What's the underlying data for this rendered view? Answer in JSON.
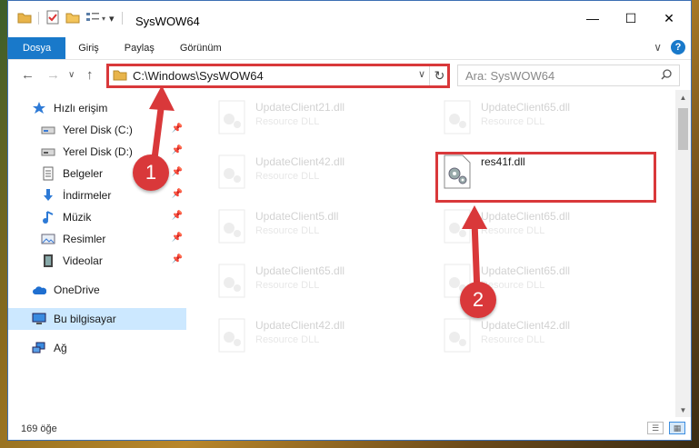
{
  "window": {
    "title": "SysWOW64",
    "minimize": "—",
    "maximize": "☐",
    "close": "✕"
  },
  "ribbon": {
    "tabs": [
      "Dosya",
      "Giriş",
      "Paylaş",
      "Görünüm"
    ],
    "expand": "∨",
    "help": "?"
  },
  "nav": {
    "back": "←",
    "forward": "→",
    "recent": "∨",
    "up": "↑",
    "address": "C:\\Windows\\SysWOW64",
    "address_dropdown": "∨",
    "refresh": "↻",
    "search_placeholder": "Ara: SysWOW64"
  },
  "sidebar": {
    "items": [
      {
        "label": "Hızlı erişim",
        "icon": "star-icon"
      },
      {
        "label": "Yerel Disk (C:)",
        "icon": "drive-icon"
      },
      {
        "label": "Yerel Disk (D:)",
        "icon": "drive-icon"
      },
      {
        "label": "Belgeler",
        "icon": "documents-icon"
      },
      {
        "label": "İndirmeler",
        "icon": "download-icon"
      },
      {
        "label": "Müzik",
        "icon": "music-icon"
      },
      {
        "label": "Resimler",
        "icon": "pictures-icon"
      },
      {
        "label": "Videolar",
        "icon": "video-icon"
      },
      {
        "label": "OneDrive",
        "icon": "cloud-icon"
      },
      {
        "label": "Bu bilgisayar",
        "icon": "computer-icon"
      },
      {
        "label": "Ağ",
        "icon": "network-icon"
      }
    ]
  },
  "files": [
    {
      "name": "UpdateClient21.dll",
      "type": "Resource DLL"
    },
    {
      "name": "UpdateClient65.dll",
      "type": "Resource DLL"
    },
    {
      "name": "UpdateClient42.dll",
      "type": "Resource DLL"
    },
    {
      "name": "res41f.dll",
      "type": ""
    },
    {
      "name": "UpdateClient5.dll",
      "type": "Resource DLL"
    },
    {
      "name": "UpdateClient65.dll",
      "type": "Resource DLL"
    },
    {
      "name": "UpdateClient65.dll",
      "type": "Resource DLL"
    },
    {
      "name": "UpdateClient65.dll",
      "type": "Resource DLL"
    },
    {
      "name": "UpdateClient42.dll",
      "type": "Resource DLL"
    },
    {
      "name": "UpdateClient42.dll",
      "type": "Resource DLL"
    }
  ],
  "status": {
    "count": "169 öğe"
  },
  "callouts": [
    "1",
    "2"
  ],
  "colors": {
    "accent": "#1979ca",
    "highlight": "#d9383a",
    "selected": "#cce8ff"
  }
}
